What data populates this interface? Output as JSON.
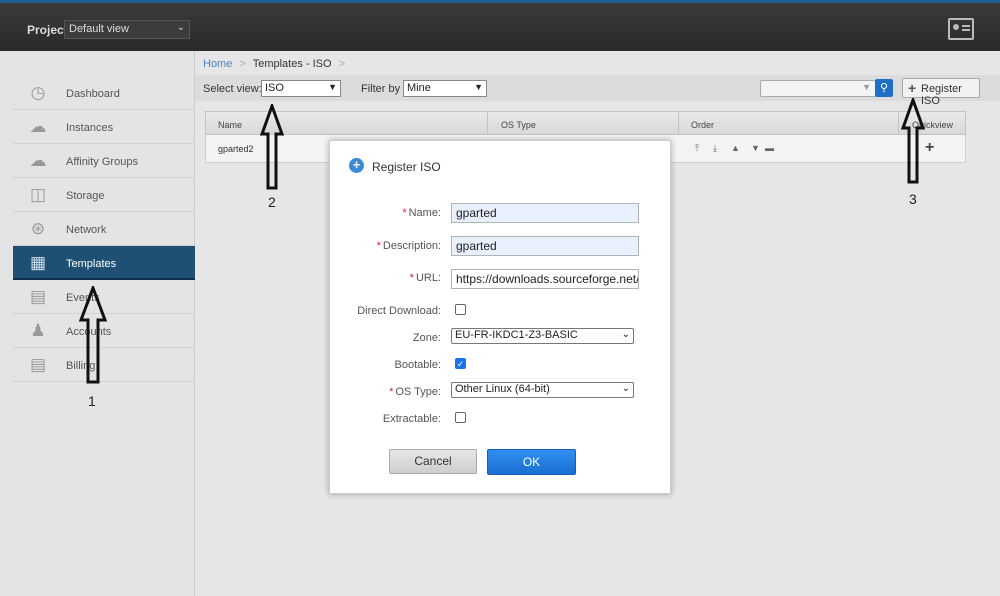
{
  "header": {
    "project_label": "Project",
    "project_value": "Default view",
    "user_icon": "user-card-icon"
  },
  "sidebar": {
    "items": [
      {
        "label": "Dashboard",
        "icon": "gauge-icon"
      },
      {
        "label": "Instances",
        "icon": "cloud-icon"
      },
      {
        "label": "Affinity Groups",
        "icon": "cloud-group-icon"
      },
      {
        "label": "Storage",
        "icon": "storage-icon"
      },
      {
        "label": "Network",
        "icon": "network-icon"
      },
      {
        "label": "Templates",
        "icon": "templates-icon"
      },
      {
        "label": "Events",
        "icon": "calendar-icon"
      },
      {
        "label": "Accounts",
        "icon": "user-icon"
      },
      {
        "label": "Billing",
        "icon": "document-icon"
      }
    ],
    "active": "Templates"
  },
  "breadcrumb": {
    "home": "Home",
    "sep": ">",
    "current": "Templates - ISO",
    "trail_sep": ">"
  },
  "toolbar": {
    "select_view_label": "Select view:",
    "select_view_value": "ISO",
    "filter_label": "Filter by",
    "filter_value": "Mine",
    "register_label": "Register ISO"
  },
  "table": {
    "headers": [
      "Name",
      "OS Type",
      "Order",
      "Quickview"
    ],
    "rows": [
      {
        "name": "gparted2"
      }
    ]
  },
  "annotations": {
    "n1": "1",
    "n2": "2",
    "n3": "3"
  },
  "modal": {
    "title": "Register ISO",
    "name_label": "Name:",
    "name_value": "gparted",
    "description_label": "Description:",
    "description_value": "gparted",
    "url_label": "URL:",
    "url_value": "https://downloads.sourceforge.net/gparted",
    "direct_download_label": "Direct Download:",
    "direct_download_checked": false,
    "zone_label": "Zone:",
    "zone_value": "EU-FR-IKDC1-Z3-BASIC",
    "bootable_label": "Bootable:",
    "bootable_checked": true,
    "os_type_label": "OS Type:",
    "os_type_value": "Other Linux (64-bit)",
    "extractable_label": "Extractable:",
    "extractable_checked": false,
    "required_mark": "*",
    "cancel_label": "Cancel",
    "ok_label": "OK"
  }
}
